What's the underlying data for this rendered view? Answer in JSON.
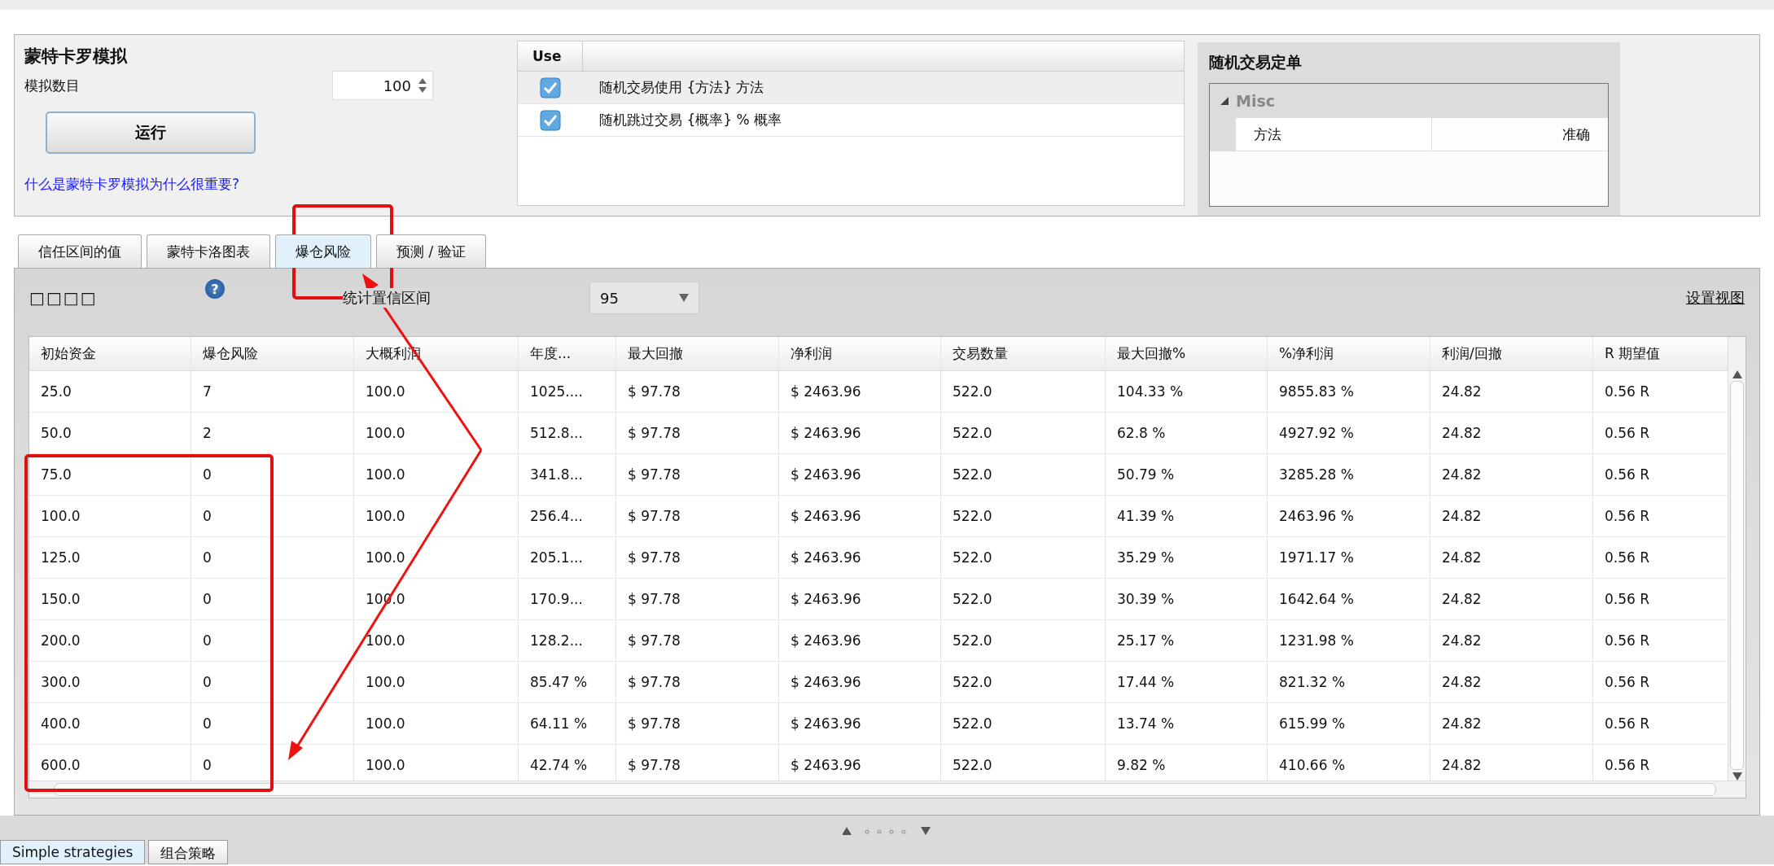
{
  "monte_carlo": {
    "title": "蒙特卡罗模拟",
    "count_label": "模拟数目",
    "count_value": "100",
    "run_button": "运行",
    "help_link": "什么是蒙特卡罗模拟为什么很重要?"
  },
  "options_table": {
    "columns": [
      "Use"
    ],
    "rows": [
      {
        "checked": true,
        "selected": true,
        "text": "随机交易使用 {方法} 方法"
      },
      {
        "checked": true,
        "selected": false,
        "text": "随机跳过交易 {概率} % 概率"
      }
    ]
  },
  "random_order": {
    "title": "随机交易定单",
    "group": {
      "name": "Misc",
      "expanded": true,
      "properties": [
        {
          "name": "方法",
          "value": "准确"
        }
      ]
    }
  },
  "tabs": [
    {
      "label": "信任区间的值",
      "selected": false
    },
    {
      "label": "蒙特卡洛图表",
      "selected": false
    },
    {
      "label": "爆仓风险",
      "selected": true
    },
    {
      "label": "预测 / 验证",
      "selected": false
    }
  ],
  "toolbar": {
    "title": "□□□□",
    "help": "?",
    "confidence_label": "统计置信区间",
    "confidence_value": "95",
    "settings_link": "设置视图"
  },
  "table": {
    "columns": [
      "初始资金",
      "爆仓风险",
      "大概利润",
      "年度...",
      "最大回撤",
      "净利润",
      "交易数量",
      "最大回撤%",
      "%净利润",
      "利润/回撤",
      "R 期望值"
    ],
    "rows": [
      [
        "25.0",
        "7",
        "100.0",
        "1025....",
        "$ 97.78",
        "$ 2463.96",
        "522.0",
        "104.33 %",
        "9855.83 %",
        "24.82",
        "0.56 R"
      ],
      [
        "50.0",
        "2",
        "100.0",
        "512.8...",
        "$ 97.78",
        "$ 2463.96",
        "522.0",
        "62.8 %",
        "4927.92 %",
        "24.82",
        "0.56 R"
      ],
      [
        "75.0",
        "0",
        "100.0",
        "341.8...",
        "$ 97.78",
        "$ 2463.96",
        "522.0",
        "50.79 %",
        "3285.28 %",
        "24.82",
        "0.56 R"
      ],
      [
        "100.0",
        "0",
        "100.0",
        "256.4...",
        "$ 97.78",
        "$ 2463.96",
        "522.0",
        "41.39 %",
        "2463.96 %",
        "24.82",
        "0.56 R"
      ],
      [
        "125.0",
        "0",
        "100.0",
        "205.1...",
        "$ 97.78",
        "$ 2463.96",
        "522.0",
        "35.29 %",
        "1971.17 %",
        "24.82",
        "0.56 R"
      ],
      [
        "150.0",
        "0",
        "100.0",
        "170.9...",
        "$ 97.78",
        "$ 2463.96",
        "522.0",
        "30.39 %",
        "1642.64 %",
        "24.82",
        "0.56 R"
      ],
      [
        "200.0",
        "0",
        "100.0",
        "128.2...",
        "$ 97.78",
        "$ 2463.96",
        "522.0",
        "25.17 %",
        "1231.98 %",
        "24.82",
        "0.56 R"
      ],
      [
        "300.0",
        "0",
        "100.0",
        "85.47 %",
        "$ 97.78",
        "$ 2463.96",
        "522.0",
        "17.44 %",
        "821.32 %",
        "24.82",
        "0.56 R"
      ],
      [
        "400.0",
        "0",
        "100.0",
        "64.11 %",
        "$ 97.78",
        "$ 2463.96",
        "522.0",
        "13.74 %",
        "615.99 %",
        "24.82",
        "0.56 R"
      ],
      [
        "600.0",
        "0",
        "100.0",
        "42.74 %",
        "$ 97.78",
        "$ 2463.96",
        "522.0",
        "9.82 %",
        "410.66 %",
        "24.82",
        "0.56 R"
      ]
    ]
  },
  "bottom_tabs": [
    {
      "label": "Simple strategies",
      "selected": true
    },
    {
      "label": "组合策略",
      "selected": false
    }
  ]
}
